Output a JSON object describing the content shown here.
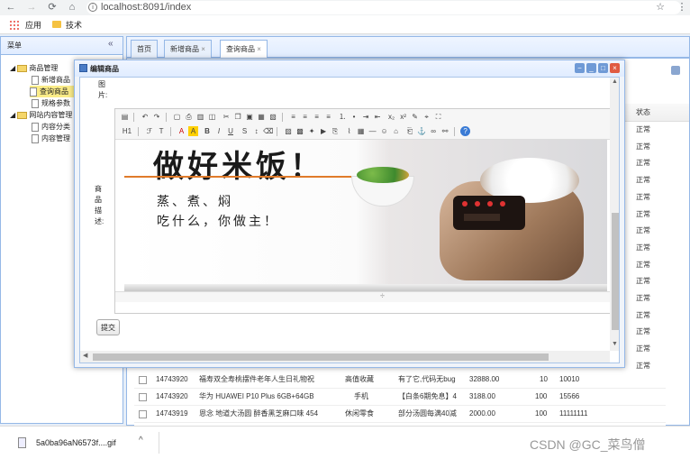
{
  "browser": {
    "url": "localhost:8091/index",
    "bookmarks": [
      {
        "label": "应用"
      },
      {
        "label": "技术"
      }
    ]
  },
  "sidebar": {
    "title": "菜单",
    "items": [
      {
        "label": "商品管理"
      },
      {
        "label": "新增商品"
      },
      {
        "label": "查询商品"
      },
      {
        "label": "规格参数"
      },
      {
        "label": "网站内容管理"
      },
      {
        "label": "内容分类"
      },
      {
        "label": "内容管理"
      }
    ]
  },
  "tabs": [
    {
      "label": "首页"
    },
    {
      "label": "新增商品"
    },
    {
      "label": "查询商品"
    }
  ],
  "grid": {
    "status_header": "状态",
    "status_value": "正常",
    "status_rows": 17,
    "rows": [
      {
        "id": "14743920",
        "title": "福寿双全寿桃摆件老年人生日礼物祝",
        "category": "高值收藏",
        "desc": "有了它,代码无bug",
        "price": "32888.00",
        "stock": "10",
        "barcode": "10010"
      },
      {
        "id": "14743920",
        "title": "华为 HUAWEI P10 Plus 6GB+64GB",
        "category": "手机",
        "desc": "【白条6期免息】4",
        "price": "3188.00",
        "stock": "100",
        "barcode": "15566"
      },
      {
        "id": "14743919",
        "title": "恩念 地道大汤圆 醉香黑芝麻口味 454",
        "category": "休闲零食",
        "desc": "部分汤圆每满40减",
        "price": "2000.00",
        "stock": "100",
        "barcode": "11111111"
      }
    ]
  },
  "dialog": {
    "title": "编辑商品",
    "field_image": "图片:",
    "field_desc_chars": [
      "商",
      "品",
      "描",
      "述:"
    ],
    "submit": "提交",
    "banner_headline": "做好米饭！",
    "banner_line1": "蒸、煮、焖",
    "banner_line2": "吃什么，你做主！",
    "toolbar_labels": [
      "H1",
      "A",
      "B",
      "I",
      "U"
    ]
  },
  "download": {
    "filename": "5a0ba96aN6573f....gif"
  },
  "watermark": "CSDN @GC_菜鸟僧",
  "colors": {
    "border": "#95b8e7",
    "selected": "#fbec88",
    "close": "#e05b42"
  }
}
